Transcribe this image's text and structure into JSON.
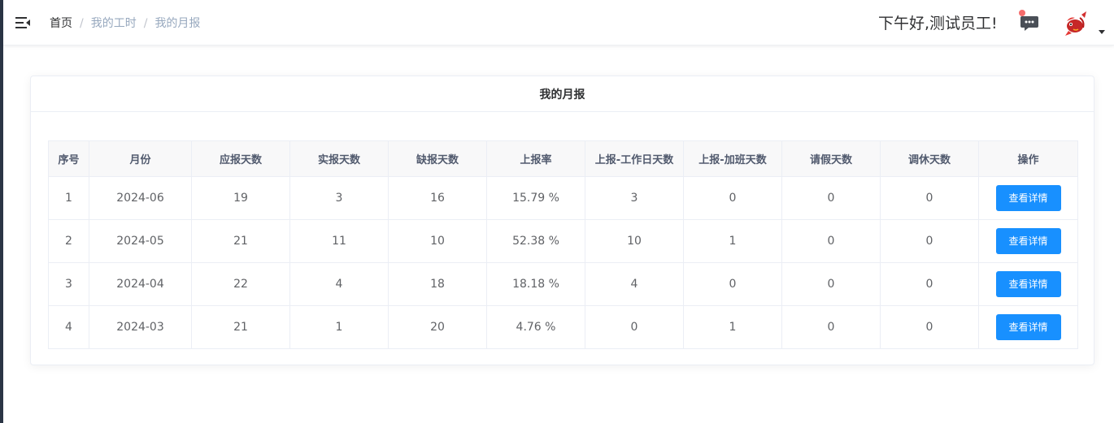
{
  "breadcrumb": [
    "首页",
    "我的工时",
    "我的月报"
  ],
  "breadcrumb_separator": "/",
  "greeting": "下午好,测试员工!",
  "icons": {
    "menu": "menu-fold-icon",
    "message": "message-icon",
    "avatar": "avatar-koi-fish",
    "dropdown": "caret-down-icon"
  },
  "colors": {
    "primary": "#1890ff",
    "badge": "#f56c6c",
    "header_bg": "#f8f8f9"
  },
  "card": {
    "title": "我的月报"
  },
  "table": {
    "columns": [
      "序号",
      "月份",
      "应报天数",
      "实报天数",
      "缺报天数",
      "上报率",
      "上报-工作日天数",
      "上报-加班天数",
      "请假天数",
      "调休天数",
      "操作"
    ],
    "action_label": "查看详情",
    "rows": [
      [
        "1",
        "2024-06",
        "19",
        "3",
        "16",
        "15.79 %",
        "3",
        "0",
        "0",
        "0"
      ],
      [
        "2",
        "2024-05",
        "21",
        "11",
        "10",
        "52.38 %",
        "10",
        "1",
        "0",
        "0"
      ],
      [
        "3",
        "2024-04",
        "22",
        "4",
        "18",
        "18.18 %",
        "4",
        "0",
        "0",
        "0"
      ],
      [
        "4",
        "2024-03",
        "21",
        "1",
        "20",
        "4.76 %",
        "0",
        "1",
        "0",
        "0"
      ]
    ]
  }
}
